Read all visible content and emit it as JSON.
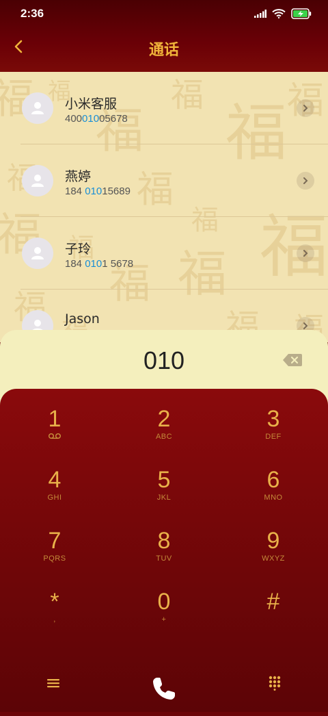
{
  "status": {
    "time": "2:36"
  },
  "header": {
    "title": "通话"
  },
  "contacts": [
    {
      "name": "小米客服",
      "num_before": "400",
      "num_hl": "010",
      "num_after": "05678"
    },
    {
      "name": "燕婷",
      "num_before": "184 ",
      "num_hl": "010",
      "num_after": "15689"
    },
    {
      "name": "子玲",
      "num_before": "184 ",
      "num_hl": "010",
      "num_after": "1 5678"
    },
    {
      "name": "Jason",
      "num_before": "",
      "num_hl": "",
      "num_after": ""
    }
  ],
  "dialer": {
    "input": "010"
  },
  "keys": [
    {
      "digit": "1",
      "letters": ""
    },
    {
      "digit": "2",
      "letters": "ABC"
    },
    {
      "digit": "3",
      "letters": "DEF"
    },
    {
      "digit": "4",
      "letters": "GHI"
    },
    {
      "digit": "5",
      "letters": "JKL"
    },
    {
      "digit": "6",
      "letters": "MNO"
    },
    {
      "digit": "7",
      "letters": "PQRS"
    },
    {
      "digit": "8",
      "letters": "TUV"
    },
    {
      "digit": "9",
      "letters": "WXYZ"
    },
    {
      "digit": "*",
      "letters": ","
    },
    {
      "digit": "0",
      "letters": "+"
    },
    {
      "digit": "#",
      "letters": ""
    }
  ],
  "colors": {
    "accent": "#e9b14a",
    "highlight": "#1a8fd6",
    "keypad_bg": "#760709",
    "list_bg": "#f2e3b2"
  },
  "icons": {
    "back": "chevron-left-icon",
    "call": "phone-icon",
    "menu": "menu-icon",
    "dialpad": "dialpad-icon",
    "backspace": "backspace-icon",
    "voicemail": "voicemail-icon"
  }
}
